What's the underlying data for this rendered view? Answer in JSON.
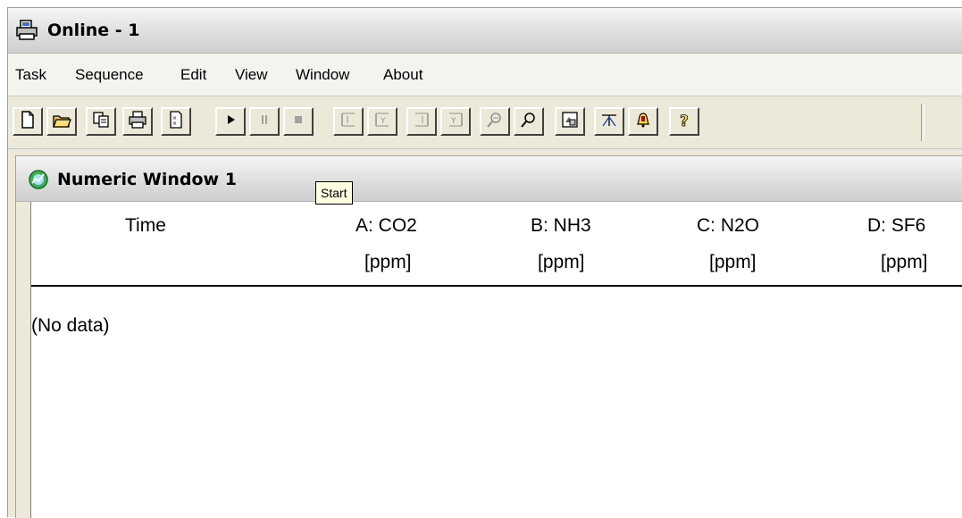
{
  "app": {
    "title": "Online - 1"
  },
  "menu": {
    "items": [
      {
        "label": "Task"
      },
      {
        "label": "Sequence"
      },
      {
        "label": "Edit"
      },
      {
        "label": "View"
      },
      {
        "label": "Window"
      },
      {
        "label": "About"
      }
    ]
  },
  "toolbar": {
    "buttons": [
      {
        "icon": "new-document-icon"
      },
      {
        "icon": "open-folder-icon"
      },
      {
        "icon": "copy-icon"
      },
      {
        "icon": "print-icon"
      },
      {
        "icon": "report-icon"
      },
      {
        "icon": "play-icon"
      },
      {
        "icon": "pause-icon"
      },
      {
        "icon": "stop-icon"
      },
      {
        "icon": "y-axis-scale-icon"
      },
      {
        "icon": "y-axis-auto-icon"
      },
      {
        "icon": "x-axis-scale-icon"
      },
      {
        "icon": "x-axis-auto-icon"
      },
      {
        "icon": "zoom-out-icon"
      },
      {
        "icon": "zoom-in-icon"
      },
      {
        "icon": "settings-icon"
      },
      {
        "icon": "limits-icon"
      },
      {
        "icon": "alarm-icon"
      },
      {
        "icon": "help-icon"
      }
    ]
  },
  "tooltip": {
    "text": "Start"
  },
  "child_window": {
    "title": "Numeric Window 1",
    "columns": [
      {
        "header": "Time",
        "unit": ""
      },
      {
        "header": "A: CO2",
        "unit": "[ppm]"
      },
      {
        "header": "B: NH3",
        "unit": "[ppm]"
      },
      {
        "header": "C: N2O",
        "unit": "[ppm]"
      },
      {
        "header": "D: SF6",
        "unit": "[ppm]"
      }
    ],
    "empty_text": "(No data)"
  },
  "colors": {
    "frame": "#ece9d8",
    "tooltip_bg": "#ffffe1",
    "title_gradient_top": "#f6f6f6",
    "title_gradient_bottom": "#cfcfcf"
  }
}
